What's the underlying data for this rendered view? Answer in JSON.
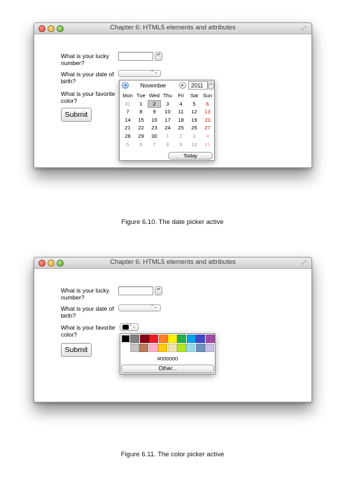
{
  "window": {
    "title": "Chapter 6: HTML5 elements and attributes"
  },
  "form": {
    "lucky_label": "What is your lucky number?",
    "dob_label": "What is your date of birth?",
    "color_label": "What is your favorite color?",
    "submit_label": "Submit",
    "stepper_glyph": "▴▾",
    "select_glyph": "⌃⌄"
  },
  "datepicker": {
    "month": "November",
    "year": "2011",
    "prev_icon": "◂",
    "next_icon": "▸",
    "today_label": "Today",
    "weekdays": [
      "Mon",
      "Tue",
      "Wed",
      "Thu",
      "Fri",
      "Sat",
      "Sun"
    ],
    "weeks": [
      [
        "31",
        "1",
        "2",
        "3",
        "4",
        "5",
        "6"
      ],
      [
        "7",
        "8",
        "9",
        "10",
        "11",
        "12",
        "13"
      ],
      [
        "14",
        "15",
        "16",
        "17",
        "18",
        "19",
        "20"
      ],
      [
        "21",
        "22",
        "23",
        "24",
        "25",
        "26",
        "27"
      ],
      [
        "28",
        "29",
        "30",
        "1",
        "2",
        "3",
        "4"
      ],
      [
        "5",
        "6",
        "7",
        "8",
        "9",
        "10",
        "11"
      ]
    ],
    "selected_day": "2"
  },
  "colorpicker": {
    "row1": [
      "#000000",
      "#7f7f7f",
      "#880015",
      "#ed1c24",
      "#ff7f27",
      "#fff200",
      "#22b14c",
      "#00a2e8",
      "#3f48cc",
      "#a349a4"
    ],
    "row2": [
      "#c3c3c3",
      "#b97a57",
      "#ffaec9",
      "#ffc90e",
      "#efe4b0",
      "#b5e61d",
      "#99d9ea",
      "#7092be",
      "#c8bfe7"
    ],
    "selected_color": "#000000",
    "hex_value": "#000000",
    "other_label": "Other..."
  },
  "captions": {
    "figure1": "Figure 6.10. The date picker active",
    "figure2": "Figure 6.11. The color picker active"
  }
}
